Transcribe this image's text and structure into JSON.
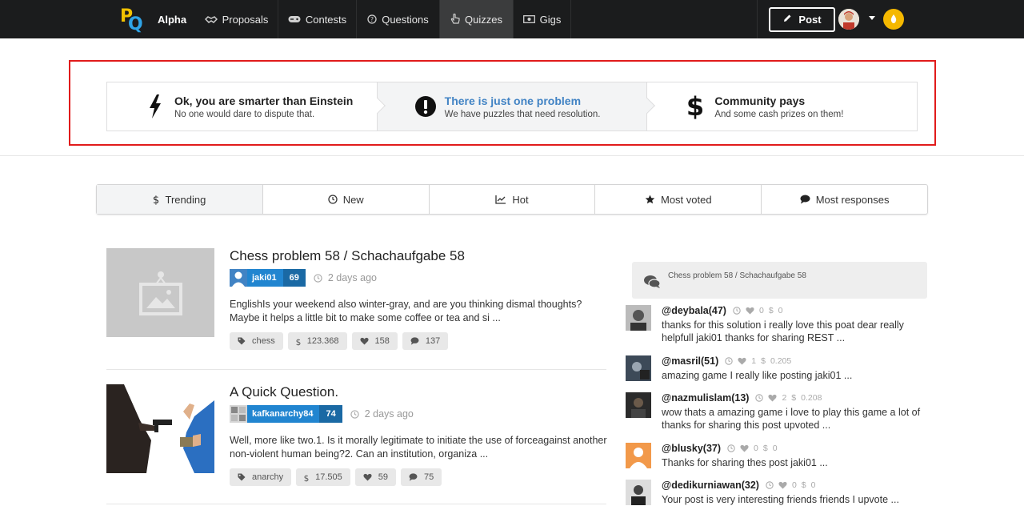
{
  "nav": {
    "brand": "Alpha",
    "items": [
      {
        "label": "Proposals",
        "icon": "handshake-icon"
      },
      {
        "label": "Contests",
        "icon": "gamepad-icon"
      },
      {
        "label": "Questions",
        "icon": "question-circle-icon"
      },
      {
        "label": "Quizzes",
        "icon": "pointer-hand-icon",
        "active": true
      },
      {
        "label": "Gigs",
        "icon": "money-bill-icon"
      }
    ],
    "post_label": "Post"
  },
  "steps": [
    {
      "title": "Ok, you are smarter than Einstein",
      "desc": "No one would dare to dispute that.",
      "icon": "lightning-icon"
    },
    {
      "title": "There is just one problem",
      "desc": "We have puzzles that need resolution.",
      "icon": "exclamation-circle-icon",
      "active": true
    },
    {
      "title": "Community pays",
      "desc": "And some cash prizes on them!",
      "icon": "dollar-icon"
    }
  ],
  "tabs": [
    {
      "label": "Trending",
      "icon": "dollar-icon",
      "active": true
    },
    {
      "label": "New",
      "icon": "clock-icon"
    },
    {
      "label": "Hot",
      "icon": "line-chart-icon"
    },
    {
      "label": "Most voted",
      "icon": "star-icon"
    },
    {
      "label": "Most responses",
      "icon": "comment-icon"
    }
  ],
  "posts": [
    {
      "title": "Chess problem 58 / Schachaufgabe 58",
      "author": "jaki01",
      "rep": "69",
      "time": "2 days ago",
      "excerpt": "EnglishIs your weekend also winter-gray, and are you thinking dismal thoughts? Maybe it helps a little bit to make some coffee or tea and si ...",
      "tag": "chess",
      "payout": "123.368",
      "votes": "158",
      "comments": "137"
    },
    {
      "title": "A Quick Question.",
      "author": "kafkanarchy84",
      "rep": "74",
      "time": "2 days ago",
      "excerpt": "Well, more like two.1. Is it morally legitimate to initiate the use of forceagainst another non-violent human being?2. Can an institution, organiza ...",
      "tag": "anarchy",
      "payout": "17.505",
      "votes": "59",
      "comments": "75"
    }
  ],
  "sidebar": {
    "title": "Chess problem 58 / Schachaufgabe 58",
    "comments": [
      {
        "user": "@deybala(47)",
        "votes": "0",
        "payout": "0",
        "body": "thanks for this solution i really love this poat dear really helpfull jaki01 thanks for sharing REST ..."
      },
      {
        "user": "@masril(51)",
        "votes": "1",
        "payout": "0.205",
        "body": "amazing game I really like posting jaki01 ..."
      },
      {
        "user": "@nazmulislam(13)",
        "votes": "2",
        "payout": "0.208",
        "body": "wow thats a amazing game i love to play this game a lot of thanks for sharing this post upvoted ..."
      },
      {
        "user": "@blusky(37)",
        "votes": "0",
        "payout": "0",
        "body": "Thanks for sharing thes post jaki01 ..."
      },
      {
        "user": "@dedikurniawan(32)",
        "votes": "0",
        "payout": "0",
        "body": "Your post is very interesting friends friends I upvote ..."
      }
    ]
  }
}
